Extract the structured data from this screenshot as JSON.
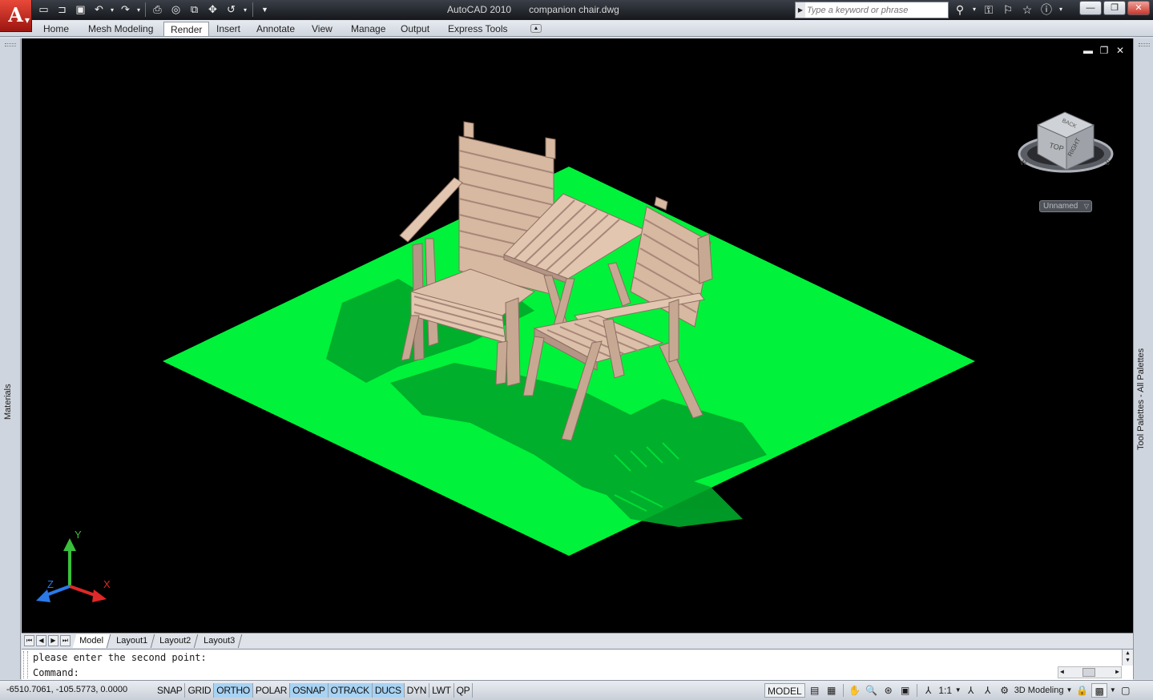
{
  "app": {
    "logo_letter": "A",
    "title": "AutoCAD 2010",
    "filename": "companion chair.dwg"
  },
  "quick_access": {
    "icons": [
      "new-icon",
      "open-icon",
      "save-icon",
      "undo-icon",
      "redo-icon",
      "plot-icon",
      "plot-preview-icon",
      "publish-icon",
      "pan-icon",
      "orbit-icon",
      "customize-icon"
    ]
  },
  "search": {
    "placeholder": "Type a keyword or phrase"
  },
  "ribbon": {
    "tabs": [
      {
        "label": "Home",
        "active": false
      },
      {
        "label": "Mesh Modeling",
        "active": false
      },
      {
        "label": "Render",
        "active": true
      },
      {
        "label": "Insert",
        "active": false
      },
      {
        "label": "Annotate",
        "active": false
      },
      {
        "label": "View",
        "active": false
      },
      {
        "label": "Manage",
        "active": false
      },
      {
        "label": "Output",
        "active": false
      },
      {
        "label": "Express Tools",
        "active": false
      }
    ]
  },
  "palettes": {
    "left": "Materials",
    "right": "Tool Palettes - All Palettes"
  },
  "viewcube": {
    "top": "TOP",
    "right": "RIGHT",
    "back": "BACK",
    "compass_w": "W",
    "compass_s": "S",
    "view_name": "Unnamed"
  },
  "ucs": {
    "x": "X",
    "y": "Y",
    "z": "Z"
  },
  "colors": {
    "ground": "#00f23a",
    "ground_shadow": "#00a82a",
    "wood": "#d7b8a0",
    "wood_dark": "#a8877a",
    "viewport_bg": "#000000"
  },
  "layout_tabs": [
    {
      "label": "Model",
      "active": true
    },
    {
      "label": "Layout1",
      "active": false
    },
    {
      "label": "Layout2",
      "active": false
    },
    {
      "label": "Layout3",
      "active": false
    }
  ],
  "command": {
    "history": "please enter the second point:",
    "prompt": "Command:"
  },
  "status": {
    "coordinates": "-6510.7061, -105.5773, 0.0000",
    "toggles": [
      {
        "label": "SNAP",
        "on": false
      },
      {
        "label": "GRID",
        "on": false
      },
      {
        "label": "ORTHO",
        "on": true
      },
      {
        "label": "POLAR",
        "on": false
      },
      {
        "label": "OSNAP",
        "on": true
      },
      {
        "label": "OTRACK",
        "on": true
      },
      {
        "label": "DUCS",
        "on": true
      },
      {
        "label": "DYN",
        "on": false
      },
      {
        "label": "LWT",
        "on": false
      },
      {
        "label": "QP",
        "on": false
      }
    ],
    "space": "MODEL",
    "annotation_scale": "1:1",
    "workspace": "3D Modeling"
  }
}
